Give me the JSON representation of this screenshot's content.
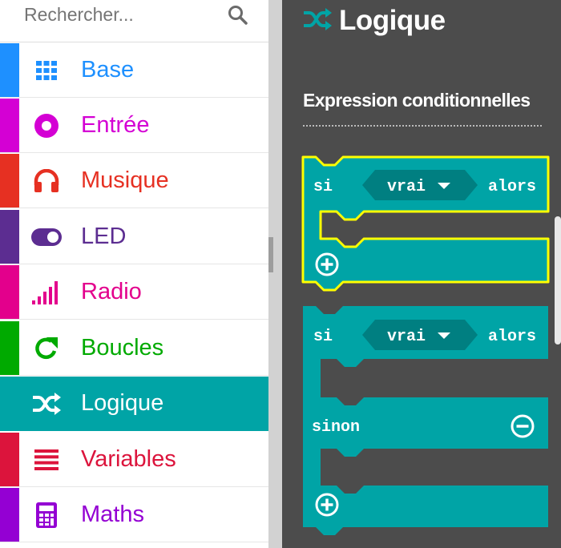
{
  "search": {
    "placeholder": "Rechercher..."
  },
  "categories": [
    {
      "label": "Base",
      "color": "#1e90ff",
      "icon": "grid-icon"
    },
    {
      "label": "Entrée",
      "color": "#d400d4",
      "icon": "radio-button-icon"
    },
    {
      "label": "Musique",
      "color": "#e63022",
      "icon": "headphones-icon"
    },
    {
      "label": "LED",
      "color": "#5c2d91",
      "icon": "toggle-icon"
    },
    {
      "label": "Radio",
      "color": "#e3008c",
      "icon": "signal-bars-icon"
    },
    {
      "label": "Boucles",
      "color": "#00aa00",
      "icon": "refresh-icon"
    },
    {
      "label": "Logique",
      "color": "#00a4a6",
      "icon": "shuffle-icon",
      "selected": true
    },
    {
      "label": "Variables",
      "color": "#dc143c",
      "icon": "list-icon"
    },
    {
      "label": "Maths",
      "color": "#9400d3",
      "icon": "calculator-icon"
    }
  ],
  "flyout": {
    "title": "Logique",
    "title_icon": "shuffle-icon",
    "section": "Expression conditionnelles",
    "block_color": "#00a4a6",
    "block_if": {
      "keyword": "si",
      "value": "vrai",
      "then": "alors"
    },
    "block_if_else": {
      "keyword": "si",
      "value": "vrai",
      "then": "alors",
      "else": "sinon"
    }
  }
}
